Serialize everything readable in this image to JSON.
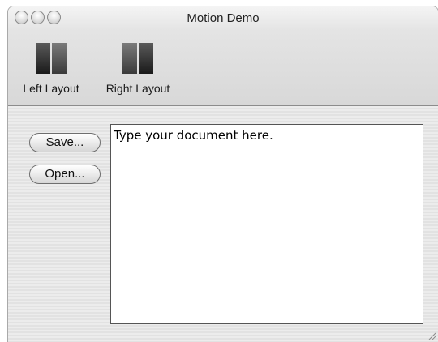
{
  "window": {
    "title": "Motion Demo"
  },
  "toolbar": {
    "items": [
      {
        "label": "Left Layout",
        "icon": "left-layout-icon"
      },
      {
        "label": "Right Layout",
        "icon": "right-layout-icon"
      }
    ]
  },
  "buttons": {
    "save_label": "Save...",
    "open_label": "Open..."
  },
  "document": {
    "text": "Type your document here."
  }
}
